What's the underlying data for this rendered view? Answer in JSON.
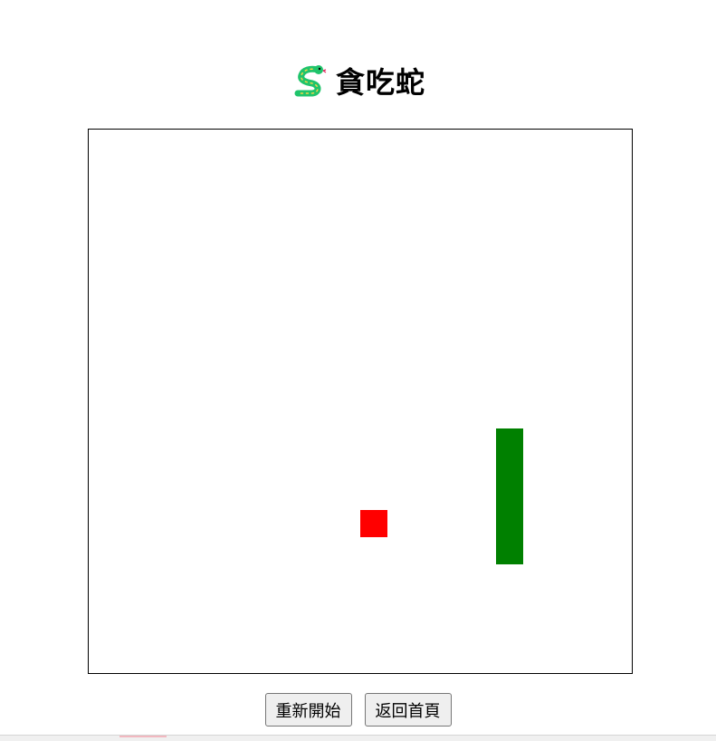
{
  "header": {
    "title": "貪吃蛇",
    "icon": "snake-icon"
  },
  "game": {
    "grid_size": 20,
    "snake": [
      {
        "col": 15,
        "row": 11
      },
      {
        "col": 15,
        "row": 12
      },
      {
        "col": 15,
        "row": 13
      },
      {
        "col": 15,
        "row": 14
      },
      {
        "col": 15,
        "row": 15
      }
    ],
    "food": {
      "col": 10,
      "row": 14
    },
    "snake_color": "#008000",
    "food_color": "#ff0000"
  },
  "controls": {
    "restart_label": "重新開始",
    "home_label": "返回首頁"
  }
}
